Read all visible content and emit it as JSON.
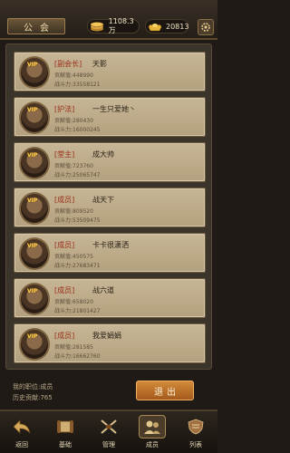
{
  "header": {
    "title": "公会",
    "resource_1": {
      "value": "1108.3万",
      "icon": "coin-stack-icon"
    },
    "resource_2": {
      "value": "20813",
      "icon": "gold-ingot-icon"
    },
    "settings_icon": "gear-icon"
  },
  "members": [
    {
      "vip": "VIP",
      "rank": "[副会长]",
      "name": "天影",
      "contribution": "贡献值:448990",
      "power": "战斗力:33558121"
    },
    {
      "vip": "VIP",
      "rank": "[护法]",
      "name": "一生只爱她丶",
      "contribution": "贡献值:280430",
      "power": "战斗力:16000245"
    },
    {
      "vip": "VIP",
      "rank": "[堂主]",
      "name": "成大帅",
      "contribution": "贡献值:723760",
      "power": "战斗力:25065747"
    },
    {
      "vip": "VIP",
      "rank": "[成员]",
      "name": "战天下",
      "contribution": "贡献值:809520",
      "power": "战斗力:53509475"
    },
    {
      "vip": "VIP",
      "rank": "[成员]",
      "name": "卡卡很潇洒",
      "contribution": "贡献值:450575",
      "power": "战斗力:27683471"
    },
    {
      "vip": "VIP",
      "rank": "[成员]",
      "name": "战六道",
      "contribution": "贡献值:658020",
      "power": "战斗力:21801427"
    },
    {
      "vip": "VIP",
      "rank": "[成员]",
      "name": "我爱娟娟",
      "contribution": "贡献值:281585",
      "power": "战斗力:16662760"
    }
  ],
  "footer": {
    "my_position": "我的职位:成员",
    "history_contribution": "历史贡献:765",
    "exit_label": "退出"
  },
  "nav": [
    {
      "label": "返回",
      "icon": "back-arrow-icon"
    },
    {
      "label": "基础",
      "icon": "scroll-icon"
    },
    {
      "label": "管理",
      "icon": "crossed-swords-icon"
    },
    {
      "label": "成员",
      "icon": "members-icon",
      "active": true
    },
    {
      "label": "列表",
      "icon": "shield-list-icon"
    }
  ]
}
